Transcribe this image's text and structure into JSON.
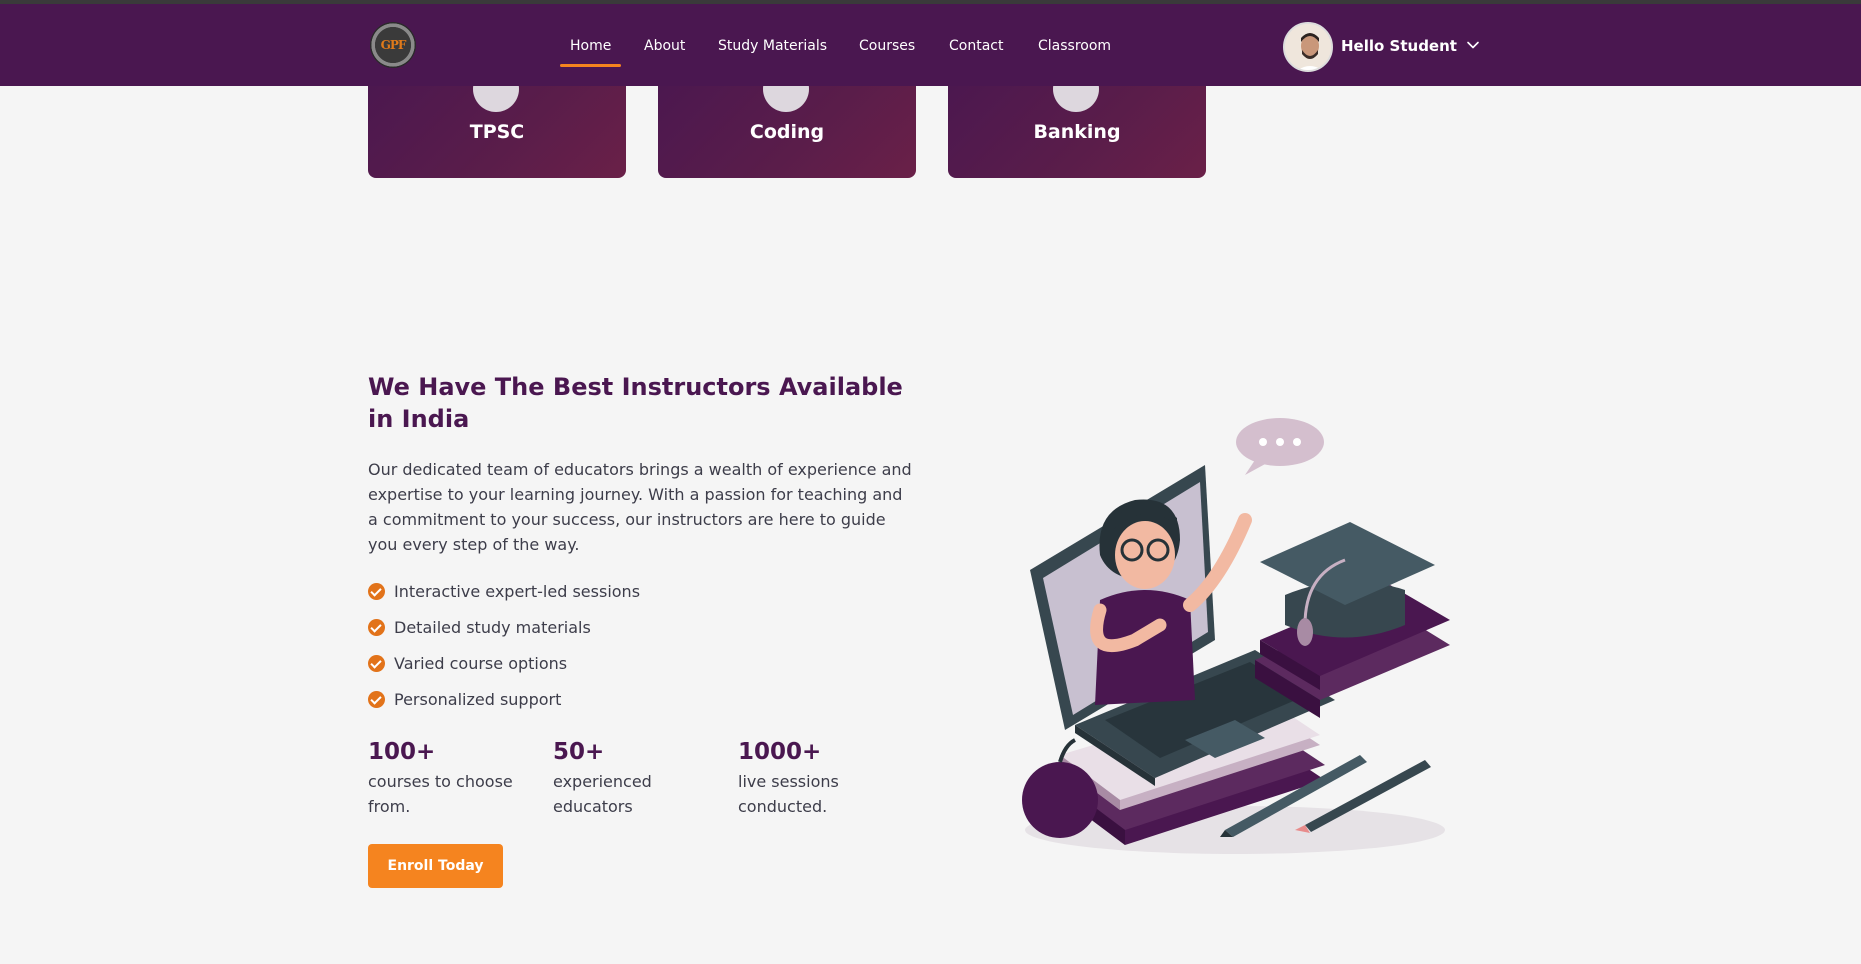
{
  "brand": {
    "logo_text": "GPF"
  },
  "nav": {
    "items": [
      {
        "label": "Home",
        "active": true
      },
      {
        "label": "About"
      },
      {
        "label": "Study Materials"
      },
      {
        "label": "Courses"
      },
      {
        "label": "Contact"
      },
      {
        "label": "Classroom"
      }
    ]
  },
  "user": {
    "greeting": "Hello Student"
  },
  "categories": [
    {
      "title": "TPSC"
    },
    {
      "title": "Coding"
    },
    {
      "title": "Banking"
    }
  ],
  "instructors": {
    "heading": "We Have The Best Instructors Available in India",
    "description": "Our dedicated team of educators brings a wealth of experience and expertise to your learning journey. With a passion for teaching and a commitment to your success, our instructors are here to guide you every step of the way.",
    "features": [
      "Interactive expert-led sessions",
      "Detailed study materials",
      "Varied course options",
      "Personalized support"
    ],
    "stats": [
      {
        "number": "100+",
        "label": "courses to choose from."
      },
      {
        "number": "50+",
        "label": "experienced educators"
      },
      {
        "number": "1000+",
        "label": "live sessions conducted."
      }
    ],
    "cta": "Enroll Today"
  },
  "colors": {
    "primary": "#4a1750",
    "accent": "#f5841f",
    "check": "#e2731a",
    "background": "#f5f5f5"
  }
}
